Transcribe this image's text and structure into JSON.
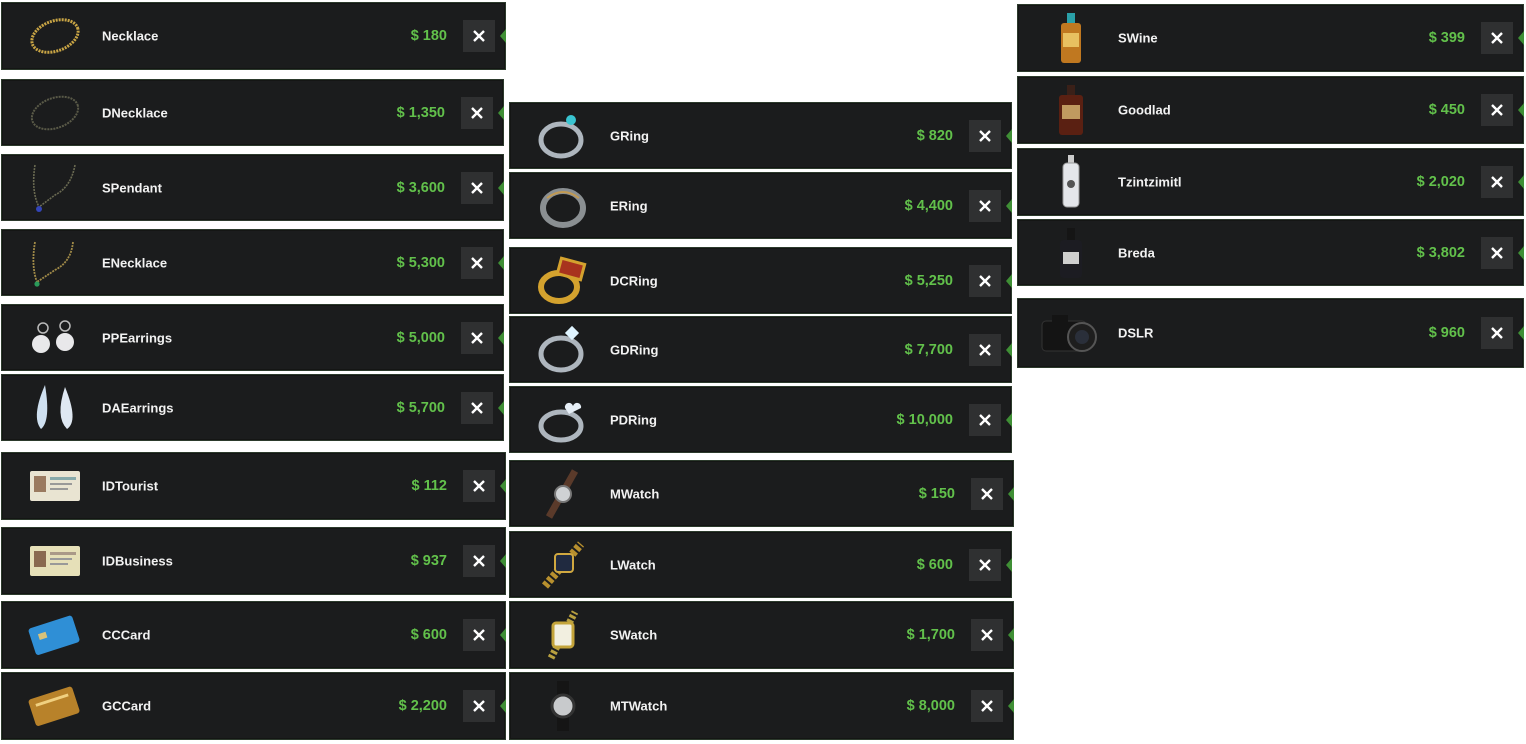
{
  "close_icon": "close-icon",
  "colors": {
    "row_bg": "#1b1c1d",
    "price": "#62c14b",
    "accent_arrow": "#3f8f35",
    "close_bg": "#2f3031"
  },
  "columns": [
    {
      "items": [
        {
          "name": "Necklace",
          "price": "$ 180",
          "icon": "gold-chain-icon"
        },
        {
          "name": "DNecklace",
          "price": "$ 1,350",
          "icon": "dark-chain-icon"
        },
        {
          "name": "SPendant",
          "price": "$ 3,600",
          "icon": "sapphire-pendant-icon"
        },
        {
          "name": "ENecklace",
          "price": "$ 5,300",
          "icon": "emerald-necklace-icon"
        },
        {
          "name": "PPEarrings",
          "price": "$ 5,000",
          "icon": "pearl-earrings-icon"
        },
        {
          "name": "DAEarrings",
          "price": "$ 5,700",
          "icon": "drop-earrings-icon"
        },
        {
          "name": "IDTourist",
          "price": "$ 112",
          "icon": "id-card-icon"
        },
        {
          "name": "IDBusiness",
          "price": "$ 937",
          "icon": "id-card-icon"
        },
        {
          "name": "CCCard",
          "price": "$ 600",
          "icon": "credit-card-icon"
        },
        {
          "name": "GCCard",
          "price": "$ 2,200",
          "icon": "gold-card-icon"
        }
      ]
    },
    {
      "items": [
        {
          "name": "GRing",
          "price": "$ 820",
          "icon": "gem-ring-icon"
        },
        {
          "name": "ERing",
          "price": "$ 4,400",
          "icon": "engraved-ring-icon"
        },
        {
          "name": "DCRing",
          "price": "$ 5,250",
          "icon": "signet-ring-icon"
        },
        {
          "name": "GDRing",
          "price": "$ 7,700",
          "icon": "diamond-ring-icon"
        },
        {
          "name": "PDRing",
          "price": "$ 10,000",
          "icon": "heart-ring-icon"
        },
        {
          "name": "MWatch",
          "price": "$ 150",
          "icon": "leather-watch-icon"
        },
        {
          "name": "LWatch",
          "price": "$ 600",
          "icon": "gold-watch-icon"
        },
        {
          "name": "SWatch",
          "price": "$ 1,700",
          "icon": "square-watch-icon"
        },
        {
          "name": "MTWatch",
          "price": "$ 8,000",
          "icon": "sport-watch-icon"
        }
      ]
    },
    {
      "items": [
        {
          "name": "SWine",
          "price": "$ 399",
          "icon": "wine-bottle-icon"
        },
        {
          "name": "Goodlad",
          "price": "$ 450",
          "icon": "whiskey-bottle-icon"
        },
        {
          "name": "Tzintzimitl",
          "price": "$ 2,020",
          "icon": "tequila-bottle-icon"
        },
        {
          "name": "Breda",
          "price": "$ 3,802",
          "icon": "dark-bottle-icon"
        },
        {
          "name": "DSLR",
          "price": "$ 960",
          "icon": "camera-icon"
        }
      ]
    }
  ]
}
